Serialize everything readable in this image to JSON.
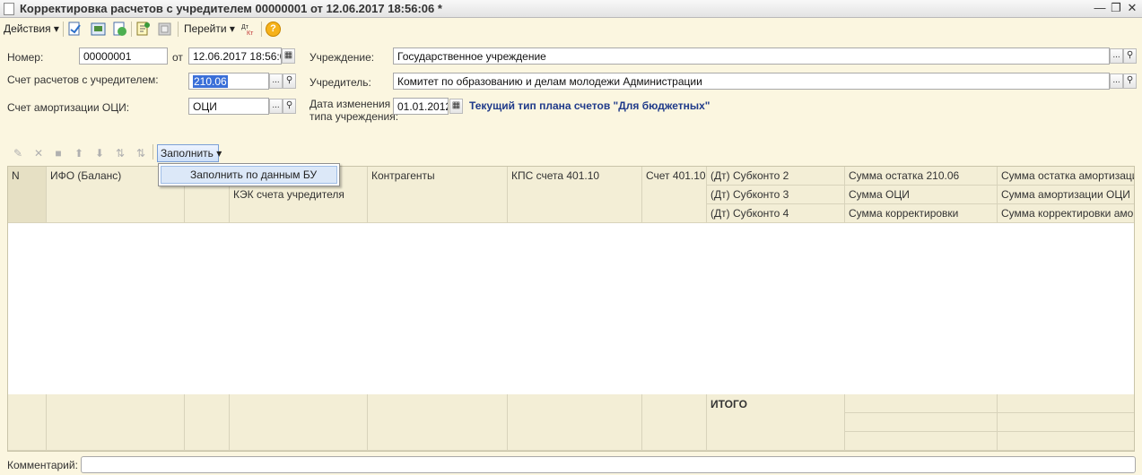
{
  "window": {
    "title": "Корректировка расчетов с учредителем 00000001 от 12.06.2017 18:56:06 *"
  },
  "toolbar": {
    "actions_label": "Действия",
    "goto_label": "Перейти"
  },
  "form": {
    "number_label": "Номер:",
    "number_value": "00000001",
    "from_label": "от",
    "date_value": "12.06.2017 18:56:06",
    "account_label": "Счет расчетов с учредителем:",
    "account_value": "210.06",
    "amort_label": "Счет амортизации ОЦИ:",
    "amort_value": "ОЦИ",
    "institution_label": "Учреждение:",
    "institution_value": "Государственное учреждение",
    "founder_label": "Учредитель:",
    "founder_value": "Комитет по образованию и делам молодежи Администрации",
    "change_date_label_1": "Дата изменения",
    "change_date_label_2": "типа учреждения:",
    "change_date_value": "01.01.2012",
    "plan_note": "Текущий тип плана счетов \"Для бюджетных\""
  },
  "table_toolbar": {
    "fill_label": "Заполнить",
    "dropdown_item": "Заполнить по данным БУ"
  },
  "grid": {
    "headers": {
      "n": "N",
      "ifo": "ИФО (Баланс)",
      "kek": "КЭК счета учредителя",
      "counterparties": "Контрагенты",
      "kps": "КПС счета 401.10",
      "account401": "Счет 401.10",
      "subkonto2": "(Дт) Субконто 2",
      "subkonto3": "(Дт) Субконто 3",
      "subkonto4": "(Дт) Субконто 4",
      "sum_balance": "Сумма остатка 210.06",
      "sum_oci": "Сумма ОЦИ",
      "sum_correction": "Сумма корректировки",
      "sum_amort_balance": "Сумма остатка амортизации",
      "sum_amort_oci": "Сумма амортизации ОЦИ",
      "sum_amort_correction": "Сумма корректировки амо..."
    },
    "total_label": "ИТОГО"
  },
  "footer": {
    "comment_label": "Комментарий:"
  },
  "colors": {
    "background": "#fbf6e0",
    "header": "#f3eed6",
    "selection": "#3a6fd8",
    "note": "#1f3a8a"
  }
}
